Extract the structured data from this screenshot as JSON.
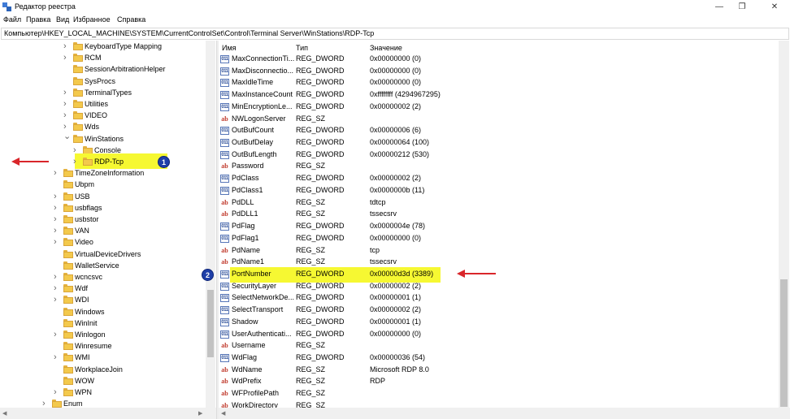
{
  "window": {
    "title": "Редактор реестра",
    "icon": "regedit-icon"
  },
  "menu": [
    "Файл",
    "Правка",
    "Вид",
    "Избранное",
    "Справка"
  ],
  "address": "Компьютер\\HKEY_LOCAL_MACHINE\\SYSTEM\\CurrentControlSet\\Control\\Terminal Server\\WinStations\\RDP-Tcp",
  "tree": [
    {
      "label": "KeyboardType Mapping",
      "level": 2,
      "expander": "collapsed"
    },
    {
      "label": "RCM",
      "level": 2,
      "expander": "collapsed"
    },
    {
      "label": "SessionArbitrationHelper",
      "level": 2,
      "expander": "none"
    },
    {
      "label": "SysProcs",
      "level": 2,
      "expander": "none"
    },
    {
      "label": "TerminalTypes",
      "level": 2,
      "expander": "collapsed"
    },
    {
      "label": "Utilities",
      "level": 2,
      "expander": "collapsed"
    },
    {
      "label": "VIDEO",
      "level": 2,
      "expander": "collapsed"
    },
    {
      "label": "Wds",
      "level": 2,
      "expander": "collapsed"
    },
    {
      "label": "WinStations",
      "level": 2,
      "expander": "expanded"
    },
    {
      "label": "Console",
      "level": 3,
      "expander": "collapsed"
    },
    {
      "label": "RDP-Tcp",
      "level": 3,
      "expander": "collapsed",
      "selected": true
    },
    {
      "label": "TimeZoneInformation",
      "level": 1,
      "expander": "collapsed"
    },
    {
      "label": "Ubpm",
      "level": 1,
      "expander": "none"
    },
    {
      "label": "USB",
      "level": 1,
      "expander": "collapsed"
    },
    {
      "label": "usbflags",
      "level": 1,
      "expander": "collapsed"
    },
    {
      "label": "usbstor",
      "level": 1,
      "expander": "collapsed"
    },
    {
      "label": "VAN",
      "level": 1,
      "expander": "collapsed"
    },
    {
      "label": "Video",
      "level": 1,
      "expander": "collapsed"
    },
    {
      "label": "VirtualDeviceDrivers",
      "level": 1,
      "expander": "none"
    },
    {
      "label": "WalletService",
      "level": 1,
      "expander": "none"
    },
    {
      "label": "wcncsvc",
      "level": 1,
      "expander": "collapsed"
    },
    {
      "label": "Wdf",
      "level": 1,
      "expander": "collapsed"
    },
    {
      "label": "WDI",
      "level": 1,
      "expander": "collapsed"
    },
    {
      "label": "Windows",
      "level": 1,
      "expander": "none"
    },
    {
      "label": "WinInit",
      "level": 1,
      "expander": "none"
    },
    {
      "label": "Winlogon",
      "level": 1,
      "expander": "collapsed"
    },
    {
      "label": "Winresume",
      "level": 1,
      "expander": "none"
    },
    {
      "label": "WMI",
      "level": 1,
      "expander": "collapsed"
    },
    {
      "label": "WorkplaceJoin",
      "level": 1,
      "expander": "none"
    },
    {
      "label": "WOW",
      "level": 1,
      "expander": "none"
    },
    {
      "label": "WPN",
      "level": 1,
      "expander": "collapsed"
    },
    {
      "label": "Enum",
      "level": 0,
      "expander": "collapsed"
    }
  ],
  "columns": {
    "name": "Имя",
    "type": "Тип",
    "data": "Значение"
  },
  "values": [
    {
      "name": "MaxConnectionTi...",
      "type": "REG_DWORD",
      "data": "0x00000000 (0)",
      "kind": "bin"
    },
    {
      "name": "MaxDisconnectio...",
      "type": "REG_DWORD",
      "data": "0x00000000 (0)",
      "kind": "bin"
    },
    {
      "name": "MaxIdleTime",
      "type": "REG_DWORD",
      "data": "0x00000000 (0)",
      "kind": "bin"
    },
    {
      "name": "MaxInstanceCount",
      "type": "REG_DWORD",
      "data": "0xffffffff (4294967295)",
      "kind": "bin"
    },
    {
      "name": "MinEncryptionLe...",
      "type": "REG_DWORD",
      "data": "0x00000002 (2)",
      "kind": "bin"
    },
    {
      "name": "NWLogonServer",
      "type": "REG_SZ",
      "data": "",
      "kind": "str"
    },
    {
      "name": "OutBufCount",
      "type": "REG_DWORD",
      "data": "0x00000006 (6)",
      "kind": "bin"
    },
    {
      "name": "OutBufDelay",
      "type": "REG_DWORD",
      "data": "0x00000064 (100)",
      "kind": "bin"
    },
    {
      "name": "OutBufLength",
      "type": "REG_DWORD",
      "data": "0x00000212 (530)",
      "kind": "bin"
    },
    {
      "name": "Password",
      "type": "REG_SZ",
      "data": "",
      "kind": "str"
    },
    {
      "name": "PdClass",
      "type": "REG_DWORD",
      "data": "0x00000002 (2)",
      "kind": "bin"
    },
    {
      "name": "PdClass1",
      "type": "REG_DWORD",
      "data": "0x0000000b (11)",
      "kind": "bin"
    },
    {
      "name": "PdDLL",
      "type": "REG_SZ",
      "data": "tdtcp",
      "kind": "str"
    },
    {
      "name": "PdDLL1",
      "type": "REG_SZ",
      "data": "tssecsrv",
      "kind": "str"
    },
    {
      "name": "PdFlag",
      "type": "REG_DWORD",
      "data": "0x0000004e (78)",
      "kind": "bin"
    },
    {
      "name": "PdFlag1",
      "type": "REG_DWORD",
      "data": "0x00000000 (0)",
      "kind": "bin"
    },
    {
      "name": "PdName",
      "type": "REG_SZ",
      "data": "tcp",
      "kind": "str"
    },
    {
      "name": "PdName1",
      "type": "REG_SZ",
      "data": "tssecsrv",
      "kind": "str"
    },
    {
      "name": "PortNumber",
      "type": "REG_DWORD",
      "data": "0x00000d3d (3389)",
      "kind": "bin",
      "highlighted": true
    },
    {
      "name": "SecurityLayer",
      "type": "REG_DWORD",
      "data": "0x00000002 (2)",
      "kind": "bin"
    },
    {
      "name": "SelectNetworkDe...",
      "type": "REG_DWORD",
      "data": "0x00000001 (1)",
      "kind": "bin"
    },
    {
      "name": "SelectTransport",
      "type": "REG_DWORD",
      "data": "0x00000002 (2)",
      "kind": "bin"
    },
    {
      "name": "Shadow",
      "type": "REG_DWORD",
      "data": "0x00000001 (1)",
      "kind": "bin"
    },
    {
      "name": "UserAuthenticati...",
      "type": "REG_DWORD",
      "data": "0x00000000 (0)",
      "kind": "bin"
    },
    {
      "name": "Username",
      "type": "REG_SZ",
      "data": "",
      "kind": "str"
    },
    {
      "name": "WdFlag",
      "type": "REG_DWORD",
      "data": "0x00000036 (54)",
      "kind": "bin"
    },
    {
      "name": "WdName",
      "type": "REG_SZ",
      "data": "Microsoft RDP 8.0",
      "kind": "str"
    },
    {
      "name": "WdPrefix",
      "type": "REG_SZ",
      "data": "RDP",
      "kind": "str"
    },
    {
      "name": "WFProfilePath",
      "type": "REG_SZ",
      "data": "",
      "kind": "str"
    },
    {
      "name": "WorkDirectory",
      "type": "REG_SZ",
      "data": "",
      "kind": "str"
    }
  ],
  "annotations": {
    "badge1": "1",
    "badge2": "2",
    "arrow_color": "#d9262a",
    "highlight_color": "#f6f832",
    "badge_color": "#1f3fa8"
  },
  "icons": {
    "reg_binary": "reg-dword-icon",
    "reg_string": "reg-sz-icon",
    "folder": "folder-icon"
  }
}
